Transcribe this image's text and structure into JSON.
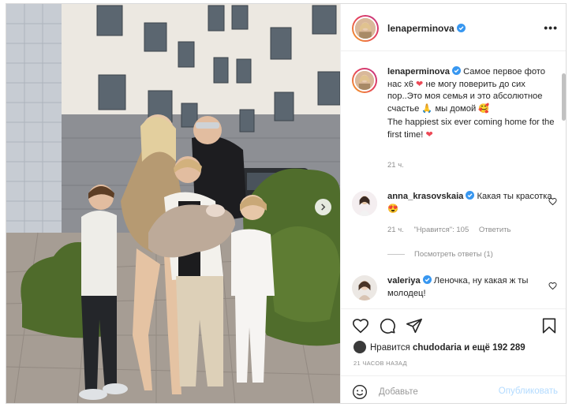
{
  "post": {
    "username": "lenaperminova",
    "more_label": "•••"
  },
  "caption": {
    "username": "lenaperminova",
    "ru_part1": "Самое первое фото нас х6",
    "ru_part2": "не могу поверить до сих пор..Это моя семья и это абсолютное счастье",
    "ru_part3": "мы домой",
    "en": "The happiest six ever coming home for the first time!",
    "time": "21 ч."
  },
  "comments": [
    {
      "username": "anna_krasovskaia",
      "text": "Какая ты красотка",
      "time": "21 ч.",
      "likes": "\"Нравится\": 105",
      "reply_label": "Ответить",
      "view_replies": "Посмотреть ответы (1)"
    },
    {
      "username": "valeriya",
      "text": "Леночка, ну какая ж ты молодец!"
    }
  ],
  "likes_summary": {
    "prefix": "Нравится",
    "user": "chudodaria",
    "suffix": "и ещё 192 289"
  },
  "time_ago": "21 ЧАСОВ НАЗАД",
  "add_comment": {
    "placeholder": "Добавьте",
    "post_label": "Опубликовать"
  },
  "colors": {
    "verified": "#3897f0",
    "link_disabled": "#b3dbff",
    "heart": "#ed4956"
  },
  "icons": [
    "next-icon",
    "more-icon",
    "verified-icon",
    "heart-icon",
    "comment-icon",
    "share-icon",
    "save-icon",
    "emoji-icon"
  ]
}
